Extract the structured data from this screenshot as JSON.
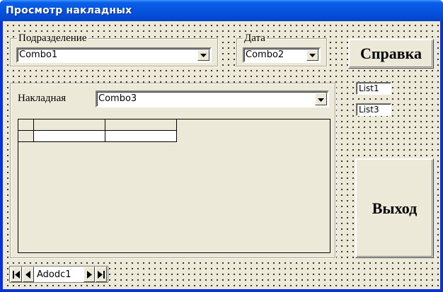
{
  "window": {
    "title": "Просмотр накладных"
  },
  "division": {
    "legend": "Подразделение",
    "combo_value": "Combo1"
  },
  "date": {
    "legend": "Дата",
    "combo_value": "Combo2"
  },
  "help_button": {
    "label": "Справка"
  },
  "invoice": {
    "label": "Накладная",
    "combo_value": "Combo3"
  },
  "lists": {
    "list1": "List1",
    "list3": "List3"
  },
  "exit_button": {
    "label": "Выход"
  },
  "adodc": {
    "caption": "Adodc1"
  },
  "icons": [
    "dropdown-arrow-icon",
    "first-record-icon",
    "prev-record-icon",
    "next-record-icon",
    "last-record-icon"
  ]
}
